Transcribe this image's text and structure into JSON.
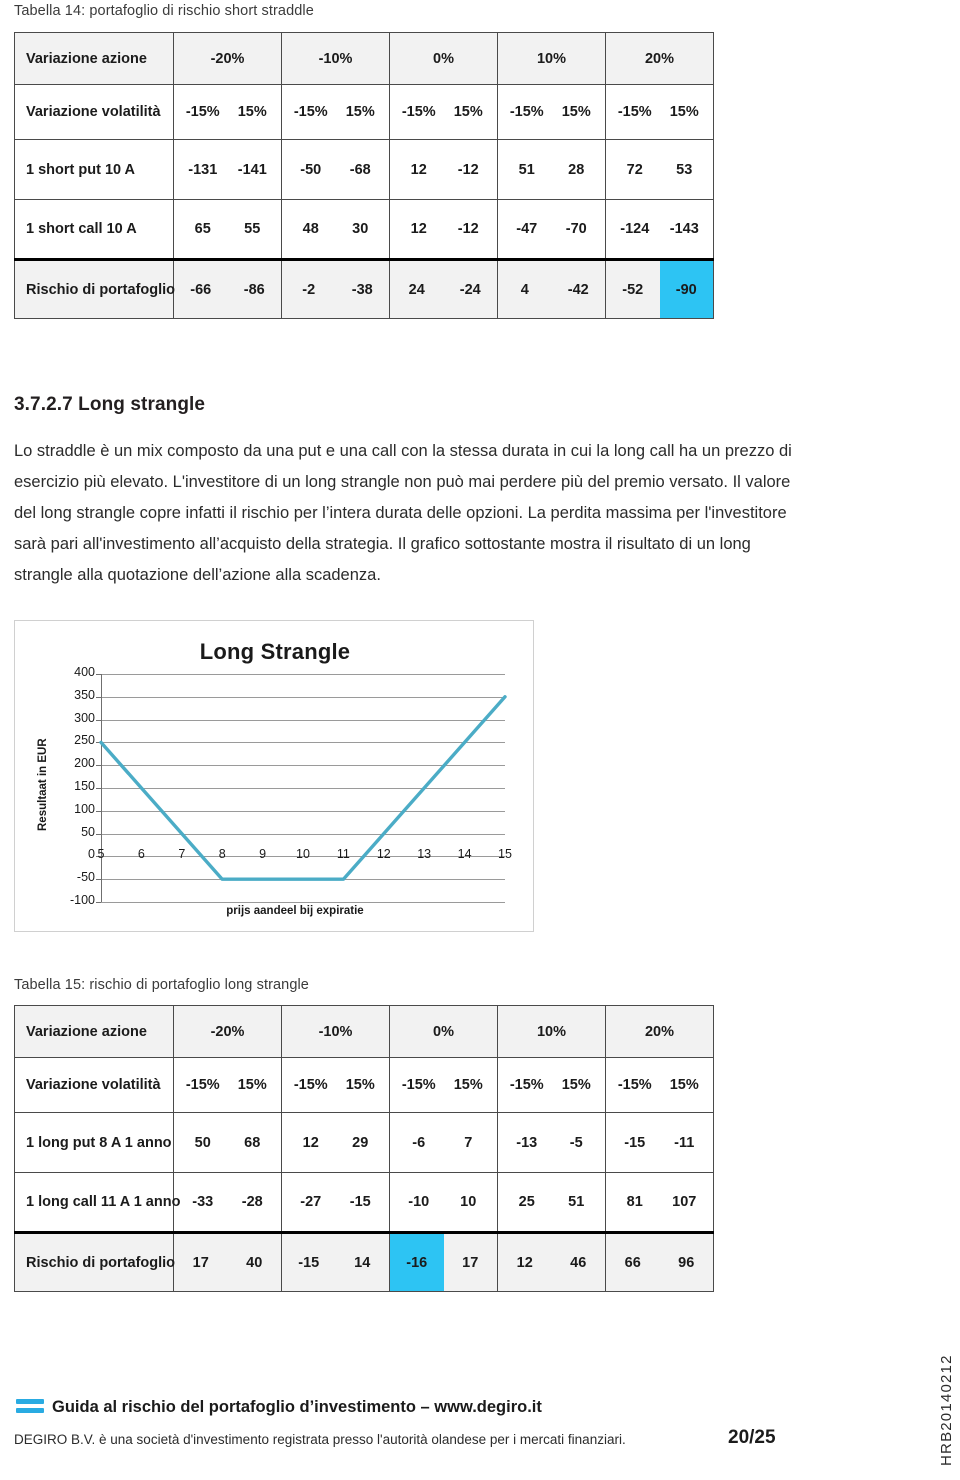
{
  "table14": {
    "caption": "Tabella 14: portafoglio di rischio short straddle",
    "header_label": "Variazione azione",
    "scenarios": [
      "-20%",
      "-10%",
      "0%",
      "10%",
      "20%"
    ],
    "vol_label": "Variazione volatilità",
    "vol_values": [
      "-15%",
      "15%",
      "-15%",
      "15%",
      "-15%",
      "15%",
      "-15%",
      "15%",
      "-15%",
      "15%"
    ],
    "rows": [
      {
        "label": "1 short put 10 A",
        "values": [
          "-131",
          "-141",
          "-50",
          "-68",
          "12",
          "-12",
          "51",
          "28",
          "72",
          "53"
        ]
      },
      {
        "label": "1 short call 10 A",
        "values": [
          "65",
          "55",
          "48",
          "30",
          "12",
          "-12",
          "-47",
          "-70",
          "-124",
          "-143"
        ]
      }
    ],
    "total": {
      "label": "Rischio di portafoglio",
      "values": [
        "-66",
        "-86",
        "-2",
        "-38",
        "24",
        "-24",
        "4",
        "-42",
        "-52",
        "-90"
      ],
      "highlight_index": 9
    }
  },
  "section": {
    "heading": "3.7.2.7 Long strangle",
    "paragraph": "Lo straddle è un mix composto da una put e una call con la stessa durata in cui la long call ha un prezzo di esercizio più elevato. L'investitore di un long strangle non può mai perdere più del premio versato. Il valore del long strangle copre infatti il rischio per l’intera durata delle opzioni. La perdita massima per l'investitore sarà pari all'investimento all’acquisto della strategia. Il grafico sottostante mostra il risultato di un long strangle alla quotazione dell’azione alla scadenza."
  },
  "chart_data": {
    "type": "line",
    "title": "Long Strangle",
    "xlabel": "prijs aandeel bij expiratie",
    "ylabel": "Resultaat in EUR",
    "x": [
      5,
      6,
      7,
      8,
      9,
      10,
      11,
      12,
      13,
      14,
      15
    ],
    "values": [
      250,
      150,
      50,
      -50,
      -50,
      -50,
      -50,
      50,
      150,
      250,
      350
    ],
    "series": [
      {
        "name": "Long Strangle",
        "values": [
          250,
          150,
          50,
          -50,
          -50,
          -50,
          -50,
          50,
          150,
          250,
          350
        ]
      }
    ],
    "xticks": [
      "5",
      "6",
      "7",
      "8",
      "9",
      "10",
      "11",
      "12",
      "13",
      "14",
      "15"
    ],
    "yticks": [
      "400",
      "350",
      "300",
      "250",
      "200",
      "150",
      "100",
      "50",
      "0",
      "-50",
      "-100"
    ],
    "ylim": [
      -100,
      400
    ],
    "xlim": [
      5,
      15
    ],
    "grid": true,
    "legend": "none",
    "line_color": "#4bacc6"
  },
  "table15": {
    "caption": "Tabella 15: rischio di portafoglio long strangle",
    "header_label": "Variazione azione",
    "scenarios": [
      "-20%",
      "-10%",
      "0%",
      "10%",
      "20%"
    ],
    "vol_label": "Variazione volatilità",
    "vol_values": [
      "-15%",
      "15%",
      "-15%",
      "15%",
      "-15%",
      "15%",
      "-15%",
      "15%",
      "-15%",
      "15%"
    ],
    "rows": [
      {
        "label": "1 long put 8 A 1 anno",
        "values": [
          "50",
          "68",
          "12",
          "29",
          "-6",
          "7",
          "-13",
          "-5",
          "-15",
          "-11"
        ]
      },
      {
        "label": "1 long call 11 A 1 anno",
        "values": [
          "-33",
          "-28",
          "-27",
          "-15",
          "-10",
          "10",
          "25",
          "51",
          "81",
          "107"
        ]
      }
    ],
    "total": {
      "label": "Rischio di portafoglio",
      "values": [
        "17",
        "40",
        "-15",
        "14",
        "-16",
        "17",
        "12",
        "46",
        "66",
        "96"
      ],
      "highlight_index": 4
    }
  },
  "footer": {
    "title": "Guida al rischio del portafoglio d’investimento – www.degiro.it",
    "disclaimer": "DEGIRO B.V. è una società d'investimento registrata presso l'autorità olandese per i mercati finanziari.",
    "page": "20/25",
    "sidecode": "HRB20140212",
    "accent": "#29abe2"
  }
}
